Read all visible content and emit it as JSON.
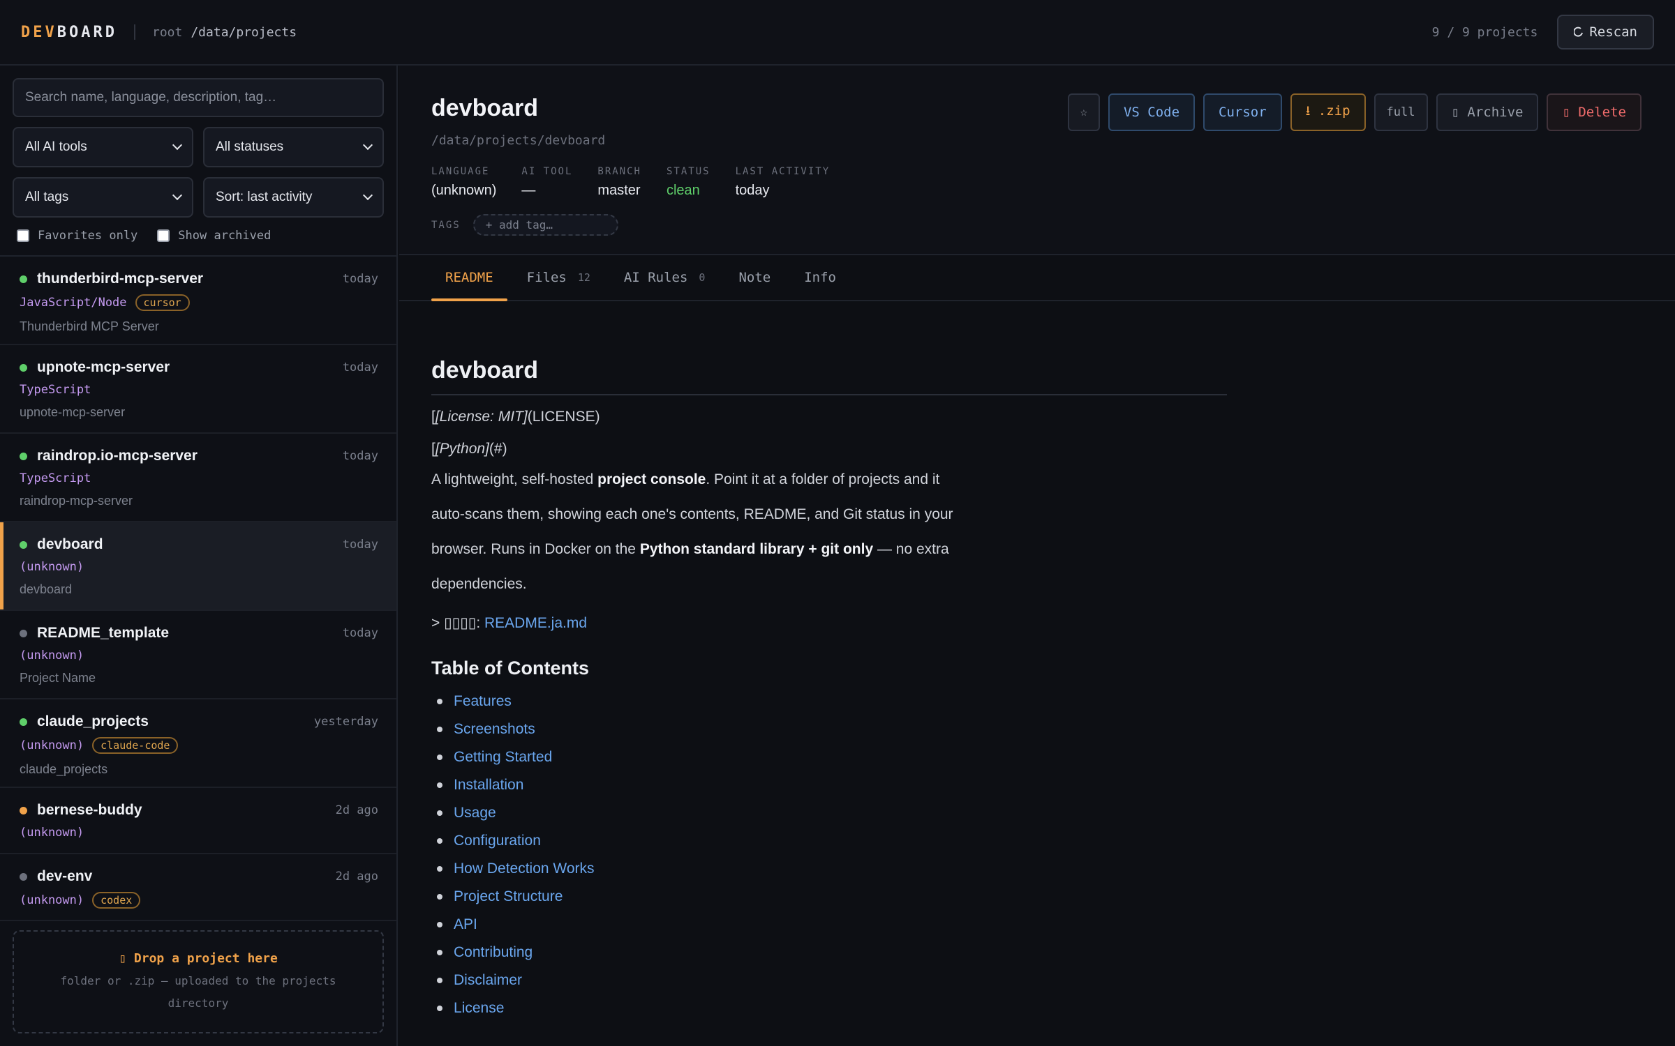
{
  "topbar": {
    "logo_a": "DEV",
    "logo_b": "BOARD",
    "user": "root",
    "path": "/data/projects",
    "count": "9 / 9 projects",
    "rescan": "Rescan"
  },
  "filters": {
    "search_placeholder": "Search name, language, description, tag…",
    "ai_tools": "All AI tools",
    "statuses": "All statuses",
    "tags": "All tags",
    "sort": "Sort: last activity",
    "favorites": "Favorites only",
    "archived": "Show archived"
  },
  "projects": [
    {
      "name": "thunderbird-mcp-server",
      "date": "today",
      "lang": "JavaScript/Node",
      "tag": "cursor",
      "desc": "Thunderbird MCP Server",
      "status": "green"
    },
    {
      "name": "upnote-mcp-server",
      "date": "today",
      "lang": "TypeScript",
      "tag": "",
      "desc": "upnote-mcp-server",
      "status": "green"
    },
    {
      "name": "raindrop.io-mcp-server",
      "date": "today",
      "lang": "TypeScript",
      "tag": "",
      "desc": "raindrop-mcp-server",
      "status": "green"
    },
    {
      "name": "devboard",
      "date": "today",
      "lang": "(unknown)",
      "tag": "",
      "desc": "devboard",
      "status": "green",
      "active": true
    },
    {
      "name": "README_template",
      "date": "today",
      "lang": "(unknown)",
      "tag": "",
      "desc": "Project Name",
      "status": "gray"
    },
    {
      "name": "claude_projects",
      "date": "yesterday",
      "lang": "(unknown)",
      "tag": "claude-code",
      "desc": "claude_projects",
      "status": "green"
    },
    {
      "name": "bernese-buddy",
      "date": "2d ago",
      "lang": "(unknown)",
      "tag": "",
      "desc": "",
      "status": "orange"
    },
    {
      "name": "dev-env",
      "date": "2d ago",
      "lang": "(unknown)",
      "tag": "codex",
      "desc": "",
      "status": "gray"
    }
  ],
  "drop": {
    "title": "Drop a project here",
    "sub": "folder or .zip — uploaded to the projects directory"
  },
  "detail": {
    "title": "devboard",
    "path": "/data/projects/devboard",
    "meta": [
      {
        "k": "LANGUAGE",
        "v": "(unknown)"
      },
      {
        "k": "AI TOOL",
        "v": "—"
      },
      {
        "k": "BRANCH",
        "v": "master"
      },
      {
        "k": "STATUS",
        "v": "clean"
      },
      {
        "k": "LAST ACTIVITY",
        "v": "today"
      }
    ],
    "tags_label": "TAGS",
    "add_tag": "+ add tag…",
    "actions": {
      "star": "☆",
      "vscode": "VS Code",
      "cursor": "Cursor",
      "zip": "⭳ .zip",
      "full": "full",
      "archive": "Archive",
      "delete": "Delete"
    }
  },
  "tabs": [
    {
      "label": "README",
      "count": ""
    },
    {
      "label": "Files",
      "count": "12"
    },
    {
      "label": "AI Rules",
      "count": "0"
    },
    {
      "label": "Note",
      "count": ""
    },
    {
      "label": "Info",
      "count": ""
    }
  ],
  "readme": {
    "h1": "devboard",
    "badge1_open": "[",
    "badge1_text": "[License: MIT]",
    "badge1_link": "(LICENSE)",
    "badge2_open": "[",
    "badge2_text": "[Python]",
    "badge2_link": "(#)",
    "p1_a": "A lightweight, self-hosted ",
    "p1_b": "project console",
    "p1_c": ". Point it at a folder of projects and it auto-scans them, showing each one's contents, README, and Git status in your browser. Runs in Docker on the ",
    "p1_d": "Python standard library + git only",
    "p1_e": " — no extra dependencies.",
    "jp_prefix": "> ▯▯▯▯: ",
    "jp_link": "README.ja.md",
    "h2": "Table of Contents",
    "toc": [
      "Features",
      "Screenshots",
      "Getting Started",
      "Installation",
      "Usage",
      "Configuration",
      "How Detection Works",
      "Project Structure",
      "API",
      "Contributing",
      "Disclaimer",
      "License"
    ]
  }
}
